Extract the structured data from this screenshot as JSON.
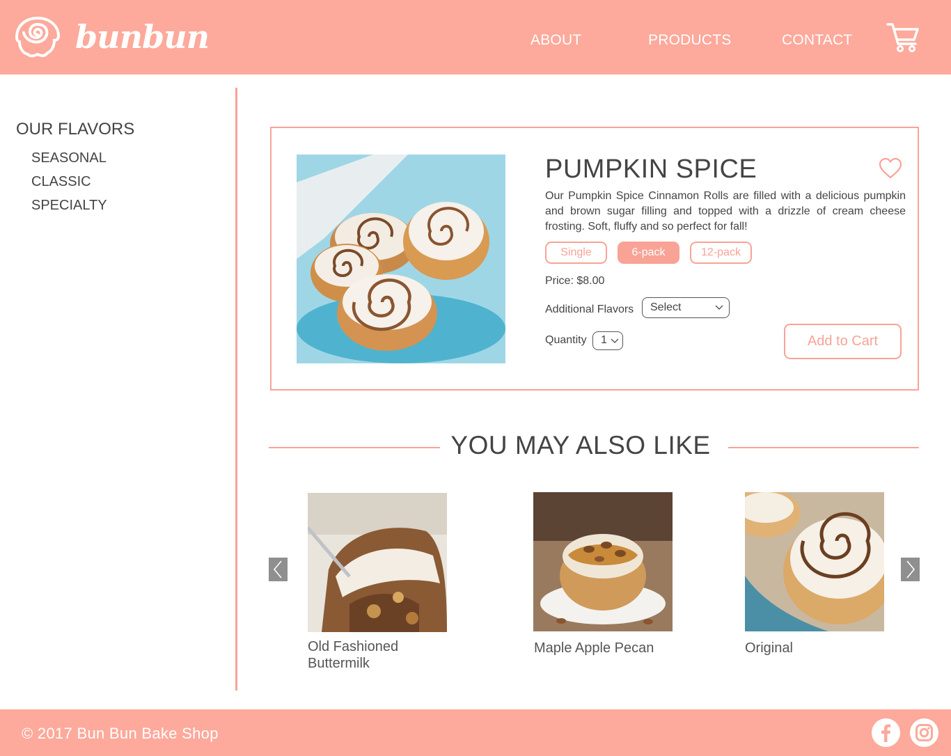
{
  "brand": {
    "name": "bunbun"
  },
  "nav": {
    "about": "ABOUT",
    "products": "PRODUCTS",
    "contact": "CONTACT"
  },
  "sidebar": {
    "title": "OUR FLAVORS",
    "items": [
      {
        "label": "SEASONAL"
      },
      {
        "label": "CLASSIC"
      },
      {
        "label": "SPECIALTY"
      }
    ]
  },
  "product": {
    "title": "PUMPKIN SPICE",
    "description": "Our Pumpkin Spice Cinnamon Rolls are filled with a delicious pumpkin and brown sugar filling and topped with a drizzle of cream cheese frosting. Soft, fluffy and so perfect for fall!",
    "sizes": [
      {
        "label": "Single",
        "selected": false
      },
      {
        "label": "6-pack",
        "selected": true
      },
      {
        "label": "12-pack",
        "selected": false
      }
    ],
    "price": "Price:  $8.00",
    "additional_flavors_label": "Additional Flavors",
    "additional_flavors_value": "Select",
    "quantity_label": "Quantity",
    "quantity_value": "1",
    "add_to_cart": "Add to Cart"
  },
  "recommendations": {
    "title": "YOU MAY ALSO LIKE",
    "items": [
      {
        "name_line1": "Old Fashioned",
        "name_line2": "Buttermilk"
      },
      {
        "name_line1": "Maple Apple Pecan",
        "name_line2": ""
      },
      {
        "name_line1": "Original",
        "name_line2": ""
      }
    ]
  },
  "footer": {
    "copyright": "© 2017 Bun Bun Bake Shop"
  },
  "colors": {
    "brand": "#fda99b",
    "accent": "#f8a396",
    "text": "#444444",
    "arrow": "#8f8f8f"
  },
  "icons": [
    "bun-logo-icon",
    "cart-icon",
    "heart-icon",
    "chevron-down-icon",
    "chevron-left-icon",
    "chevron-right-icon",
    "facebook-icon",
    "instagram-icon"
  ]
}
